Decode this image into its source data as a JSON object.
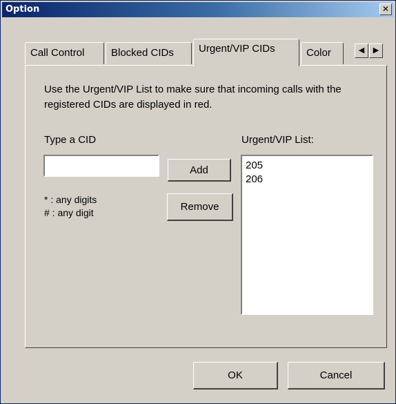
{
  "window": {
    "title": "Option",
    "close_glyph": "✕"
  },
  "tabs": [
    {
      "label": "Call Control",
      "active": false
    },
    {
      "label": "Blocked CIDs",
      "active": false
    },
    {
      "label": "Urgent/VIP CIDs",
      "active": true
    },
    {
      "label": "Color",
      "active": false
    }
  ],
  "tab_scroll": {
    "left_glyph": "◀",
    "right_glyph": "▶"
  },
  "panel": {
    "description": "Use the Urgent/VIP List to make sure that incoming calls with the registered CIDs are displayed in red.",
    "cid_label": "Type a CID",
    "cid_input_value": "",
    "add_label": "Add",
    "remove_label": "Remove",
    "hint_any_digits": "* : any digits",
    "hint_any_digit": "# : any digit",
    "list_label": "Urgent/VIP List:",
    "list_items": [
      "205",
      "206"
    ]
  },
  "footer": {
    "ok_label": "OK",
    "cancel_label": "Cancel"
  }
}
